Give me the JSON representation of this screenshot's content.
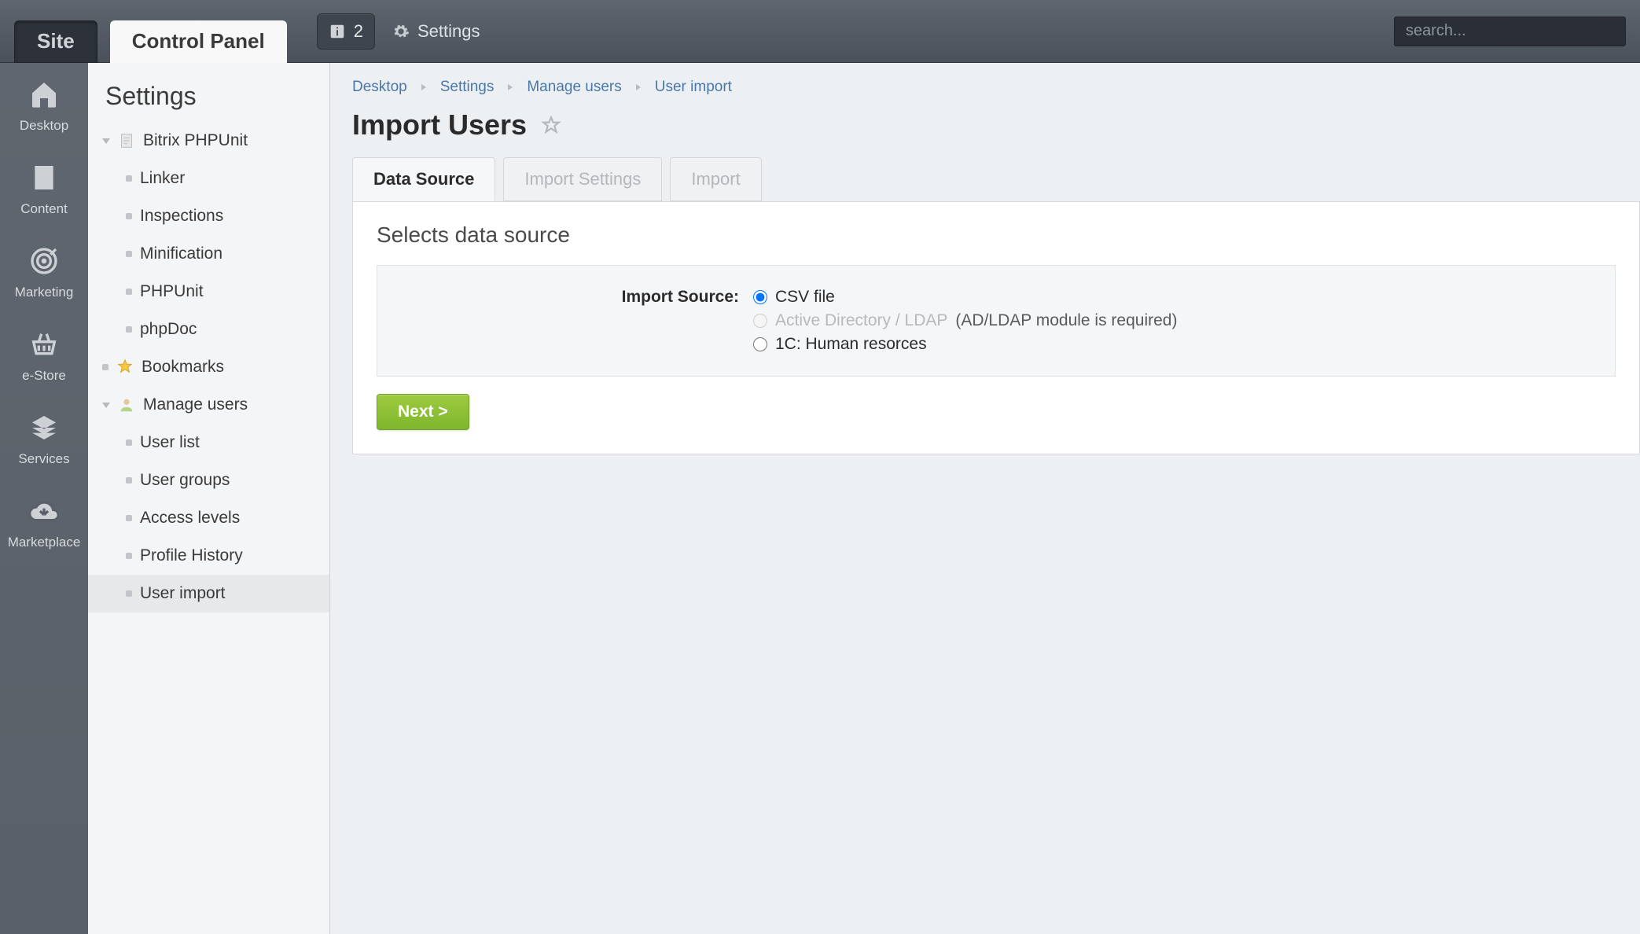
{
  "topbar": {
    "site_tab": "Site",
    "cp_tab": "Control Panel",
    "notif_count": "2",
    "settings_label": "Settings",
    "search_placeholder": "search..."
  },
  "rail": [
    {
      "key": "desktop",
      "label": "Desktop"
    },
    {
      "key": "content",
      "label": "Content"
    },
    {
      "key": "marketing",
      "label": "Marketing"
    },
    {
      "key": "estore",
      "label": "e-Store"
    },
    {
      "key": "services",
      "label": "Services"
    },
    {
      "key": "marketplace",
      "label": "Marketplace"
    }
  ],
  "tree": {
    "title": "Settings",
    "items": {
      "phpunit_root": "Bitrix PHPUnit",
      "linker": "Linker",
      "inspections": "Inspections",
      "minification": "Minification",
      "phpunit": "PHPUnit",
      "phpdoc": "phpDoc",
      "bookmarks": "Bookmarks",
      "manage_users": "Manage users",
      "user_list": "User list",
      "user_groups": "User groups",
      "access_levels": "Access levels",
      "profile_history": "Profile History",
      "user_import": "User import"
    }
  },
  "crumbs": [
    "Desktop",
    "Settings",
    "Manage users",
    "User import"
  ],
  "page": {
    "title": "Import Users",
    "tabs": {
      "data_source": "Data Source",
      "import_settings": "Import Settings",
      "import": "Import"
    },
    "panel_heading": "Selects data source",
    "form_label": "Import Source:",
    "options": {
      "csv": "CSV file",
      "ldap": "Active Directory / LDAP",
      "ldap_hint": "(AD/LDAP module is required)",
      "onec": "1C: Human resorces"
    },
    "next_btn": "Next >"
  }
}
